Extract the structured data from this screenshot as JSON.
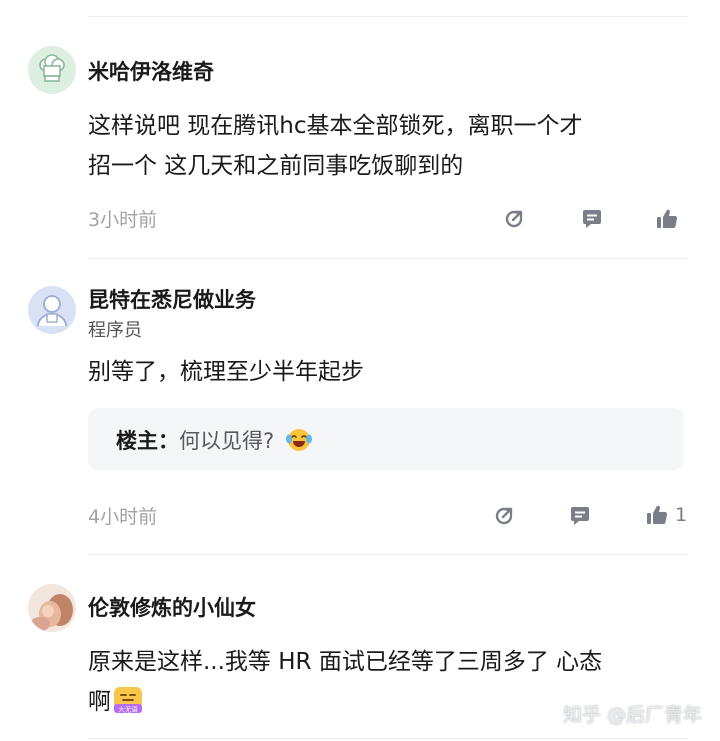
{
  "comments": [
    {
      "author": "米哈伊洛维奇",
      "avatar_icon": "chef-hat-avatar",
      "text_line1": "这样说吧 现在腾讯hc基本全部锁死，离职一个才",
      "text_line2": "招一个 这几天和之前同事吃饭聊到的",
      "time": "3小时前",
      "like_count": ""
    },
    {
      "author": "昆特在悉尼做业务",
      "role": "程序员",
      "avatar_icon": "default-user-avatar",
      "text": "别等了，梳理至少半年起步",
      "reply_author": "楼主：",
      "reply_text": "何以见得?",
      "reply_emoji": "laughing-tears-emoji",
      "time": "4小时前",
      "like_count": "1"
    },
    {
      "author": "伦敦修炼的小仙女",
      "avatar_icon": "photo-avatar",
      "text_line1": "原来是这样...我等 HR 面试已经等了三周多了 心态",
      "text_line2": "啊",
      "text_emoji": "collapse-emoji",
      "emoji_caption": "大无语"
    }
  ],
  "watermark": "知乎 @后厂青年",
  "colors": {
    "text": "#1a1a1a",
    "secondary": "#a3a3a3",
    "icon": "#7a7f87",
    "reply_bg": "#f5f6f7",
    "avatar_green": "#dcefe0",
    "avatar_blue": "#d9e2f4"
  }
}
